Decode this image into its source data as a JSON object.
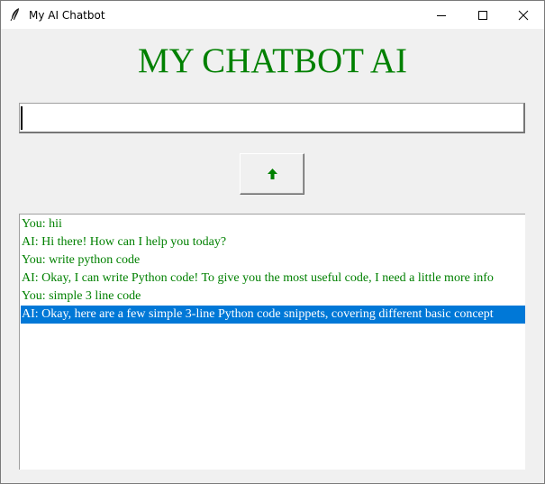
{
  "window": {
    "title": "My AI Chatbot",
    "app_icon": "feather-icon",
    "controls": [
      "minimize-icon",
      "maximize-icon",
      "close-icon"
    ]
  },
  "main": {
    "heading": "MY CHATBOT AI",
    "input": {
      "value": "",
      "placeholder": ""
    },
    "send_button_icon": "arrow-up-icon",
    "colors": {
      "text_green": "#008000",
      "selection_blue": "#0078d7",
      "background": "#f0f0f0"
    }
  },
  "chat": {
    "lines": [
      {
        "text": "You: hii",
        "selected": false
      },
      {
        "text": "AI: Hi there! How can I help you today?",
        "selected": false
      },
      {
        "text": "You: write python code",
        "selected": false
      },
      {
        "text": "AI: Okay, I can write Python code! To give you the most useful code, I need a little more info",
        "selected": false
      },
      {
        "text": "You: simple 3 line code",
        "selected": false
      },
      {
        "text": "AI: Okay, here are a few simple 3-line Python code snippets, covering different basic concept",
        "selected": true
      }
    ]
  }
}
